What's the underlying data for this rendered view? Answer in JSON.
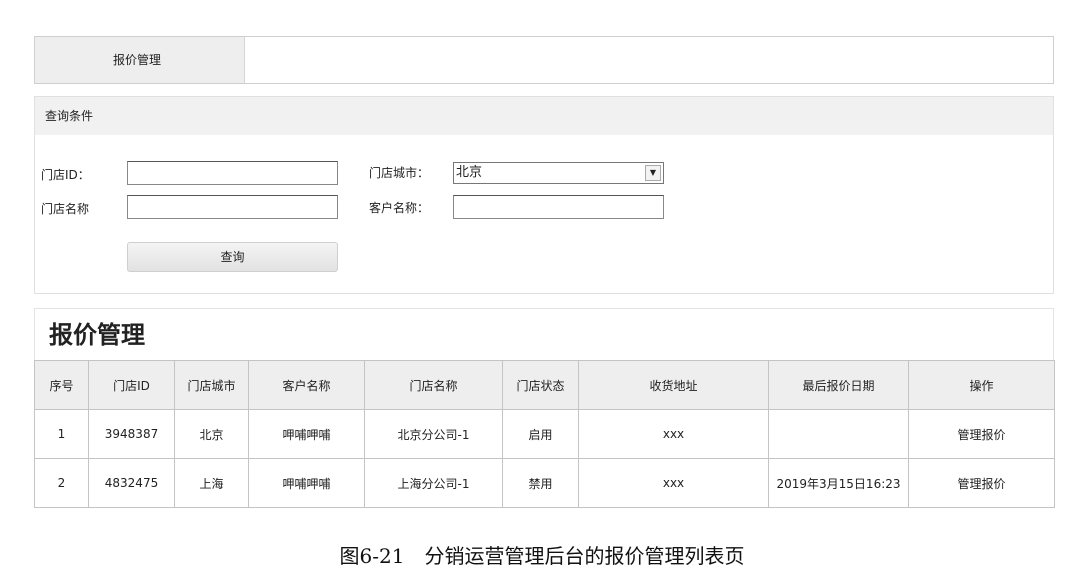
{
  "top_tab": {
    "label": "报价管理"
  },
  "query": {
    "header": "查询条件",
    "store_id_label": "门店ID：",
    "store_id_value": "",
    "store_name_label": "门店名称",
    "store_name_value": "",
    "store_city_label": "门店城市：",
    "store_city_value": "北京",
    "customer_name_label": "客户名称：",
    "customer_name_value": "",
    "search_button": "查询"
  },
  "list": {
    "title": "报价管理",
    "columns": [
      "序号",
      "门店ID",
      "门店城市",
      "客户名称",
      "门店名称",
      "门店状态",
      "收货地址",
      "最后报价日期",
      "操作"
    ],
    "rows": [
      [
        "1",
        "3948387",
        "北京",
        "呷哺呷哺",
        "北京分公司-1",
        "启用",
        "xxx",
        "",
        "管理报价"
      ],
      [
        "2",
        "4832475",
        "上海",
        "呷哺呷哺",
        "上海分公司-1",
        "禁用",
        "xxx",
        "2019年3月15日16:23",
        "管理报价"
      ]
    ]
  },
  "caption": "图6-21　分销运营管理后台的报价管理列表页"
}
